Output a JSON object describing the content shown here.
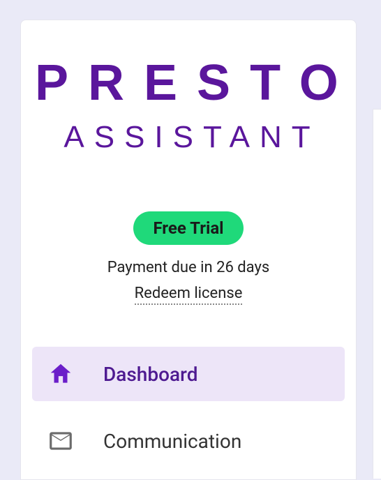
{
  "logo": {
    "line1": "PRESTO",
    "line2": "ASSISTANT"
  },
  "trial": {
    "badge_label": "Free Trial",
    "payment_due_text": "Payment due in 26 days",
    "redeem_label": "Redeem license"
  },
  "nav": {
    "items": [
      {
        "label": "Dashboard",
        "icon": "home-icon",
        "active": true
      },
      {
        "label": "Communication",
        "icon": "mail-icon",
        "active": false
      }
    ]
  },
  "colors": {
    "brand_purple": "#5a169c",
    "active_bg": "#ede5f8",
    "trial_green": "#1fd97a"
  }
}
